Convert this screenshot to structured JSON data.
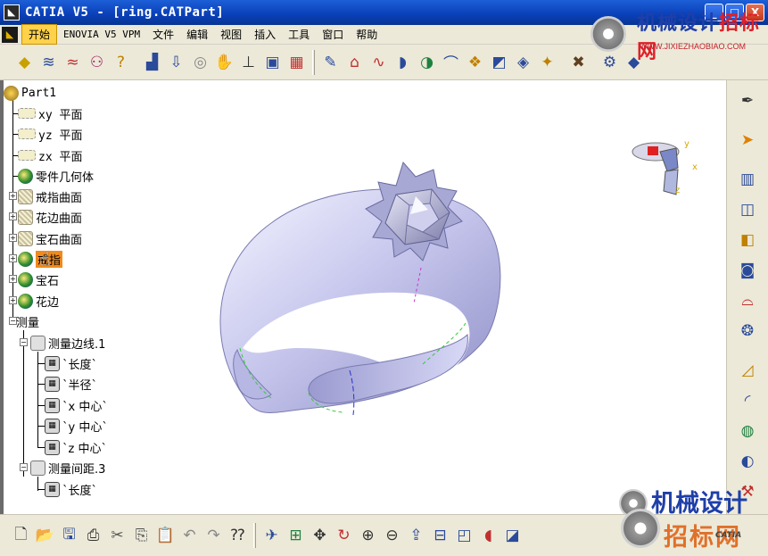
{
  "window": {
    "title": "CATIA V5 - [ring.CATPart]",
    "buttons": [
      "_",
      "□",
      "X"
    ]
  },
  "menu": {
    "items": [
      "开始",
      "ENOVIA V5 VPM",
      "文件",
      "编辑",
      "视图",
      "插入",
      "工具",
      "窗口",
      "帮助"
    ]
  },
  "tree": {
    "root": "Part1",
    "planes": [
      "xy 平面",
      "yz 平面",
      "zx 平面"
    ],
    "bodies": [
      "零件几何体",
      "戒指曲面",
      "花边曲面",
      "宝石曲面",
      "戒指",
      "宝石",
      "花边"
    ],
    "highlighted": "戒指",
    "measure": "测量",
    "measure_edge": "测量边线.1",
    "edge_params": [
      "`长度`",
      "`半径`",
      "`x 中心`",
      "`y 中心`",
      "`z 中心`"
    ],
    "measure_between": "测量间距.3",
    "between_params": [
      "`长度`"
    ]
  },
  "compass": {
    "x_label": "x",
    "y_label": "y",
    "z_label": "z"
  },
  "watermark": {
    "title_a": "机械设计",
    "title_b": "招标网",
    "url": "WWW.JIXIEZHAOBIAO.COM",
    "bottom_l1": "机械设计",
    "bottom_l2": "招标网",
    "catia": "CATIA"
  },
  "colors": {
    "titlebar": "#0a3fb8",
    "toolbar_bg": "#ece9d8",
    "ring": "#c9c9f0",
    "highlight": "#f08a1c"
  }
}
